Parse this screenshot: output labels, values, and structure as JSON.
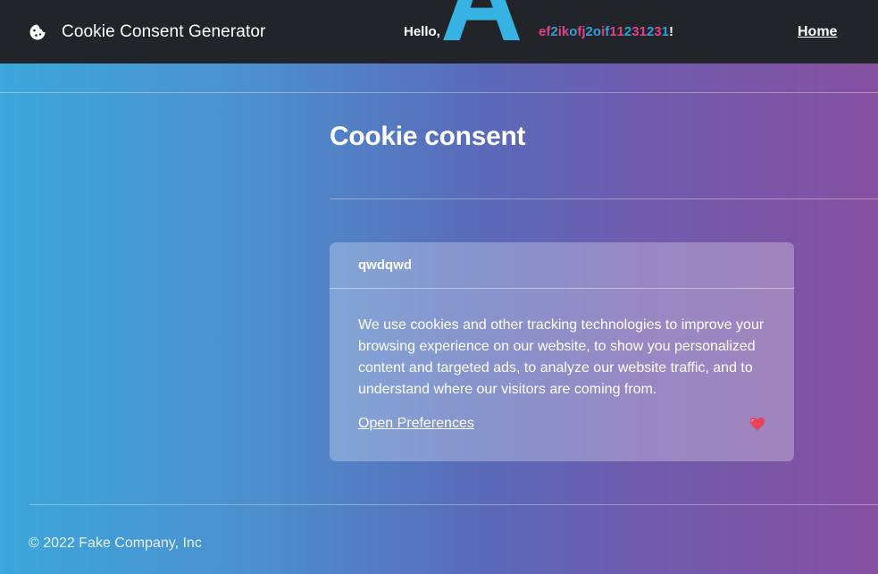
{
  "navbar": {
    "brand_icon": "cookie-icon",
    "brand_text": "Cookie Consent Generator",
    "greeting_prefix": "Hello, ",
    "greeting_big_letter": "A",
    "user_name_chars": [
      {
        "ch": "e",
        "color": "#e0428a"
      },
      {
        "ch": "f",
        "color": "#e0428a"
      },
      {
        "ch": "2",
        "color": "#2f9fd8"
      },
      {
        "ch": "i",
        "color": "#e0428a"
      },
      {
        "ch": "k",
        "color": "#e0428a"
      },
      {
        "ch": "o",
        "color": "#2f9fd8"
      },
      {
        "ch": "f",
        "color": "#e0428a"
      },
      {
        "ch": "j",
        "color": "#e0428a"
      },
      {
        "ch": "2",
        "color": "#2f9fd8"
      },
      {
        "ch": "o",
        "color": "#2f9fd8"
      },
      {
        "ch": "i",
        "color": "#e0428a"
      },
      {
        "ch": "f",
        "color": "#2f9fd8"
      },
      {
        "ch": "1",
        "color": "#e0428a"
      },
      {
        "ch": "1",
        "color": "#e0428a"
      },
      {
        "ch": "2",
        "color": "#2f9fd8"
      },
      {
        "ch": "3",
        "color": "#e0428a"
      },
      {
        "ch": "1",
        "color": "#e0428a"
      },
      {
        "ch": "2",
        "color": "#2f9fd8"
      },
      {
        "ch": "3",
        "color": "#e0428a"
      },
      {
        "ch": "1",
        "color": "#2f9fd8"
      }
    ],
    "greeting_suffix": "!",
    "home_link": "Home"
  },
  "page": {
    "title": "Cookie consent"
  },
  "consent_card": {
    "header": "qwdqwd",
    "body_text": "We use cookies and other tracking technologies to improve your browsing experience on our website, to show you personalized content and targeted ads, to analyze our website traffic, and to understand where our visitors are coming from.",
    "preferences_link": "Open Preferences",
    "footer_icon": "heart-icon"
  },
  "footer": {
    "copyright": "© 2022 Fake Company, Inc"
  },
  "colors": {
    "navbar_bg": "#212429",
    "accent_blue": "#36b3e3",
    "accent_pink": "#e0428a",
    "heart": "#e8435a"
  }
}
